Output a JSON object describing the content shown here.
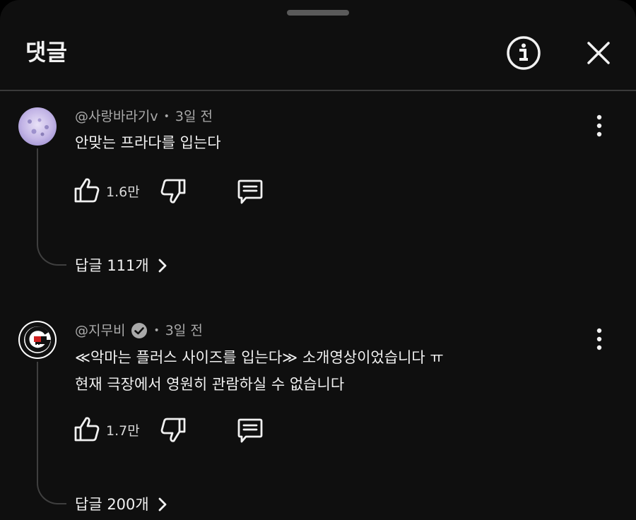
{
  "header": {
    "title": "댓글",
    "info_icon": "info-circle-icon",
    "close_icon": "close-icon"
  },
  "comments": [
    {
      "author": "@사랑바라기v",
      "separator": "•",
      "time": "3일 전",
      "verified": false,
      "text_lines": [
        "안맞는 프라다를 입는다"
      ],
      "likes": "1.6만",
      "replies_label": "답글 111개"
    },
    {
      "author": "@지무비",
      "separator": "•",
      "time": "3일 전",
      "verified": true,
      "text_lines": [
        "≪악마는 플러스 사이즈를 입는다≫ 소개영상이었습니다 ㅠ",
        "현재 극장에서 영원히 관람하실 수 없습니다"
      ],
      "likes": "1.7만",
      "replies_label": "답글 200개"
    }
  ],
  "colors": {
    "background": "#0f0f0f",
    "text": "#f1f1f1",
    "secondary_text": "#aaaaaa",
    "divider": "#3a3a3a"
  }
}
